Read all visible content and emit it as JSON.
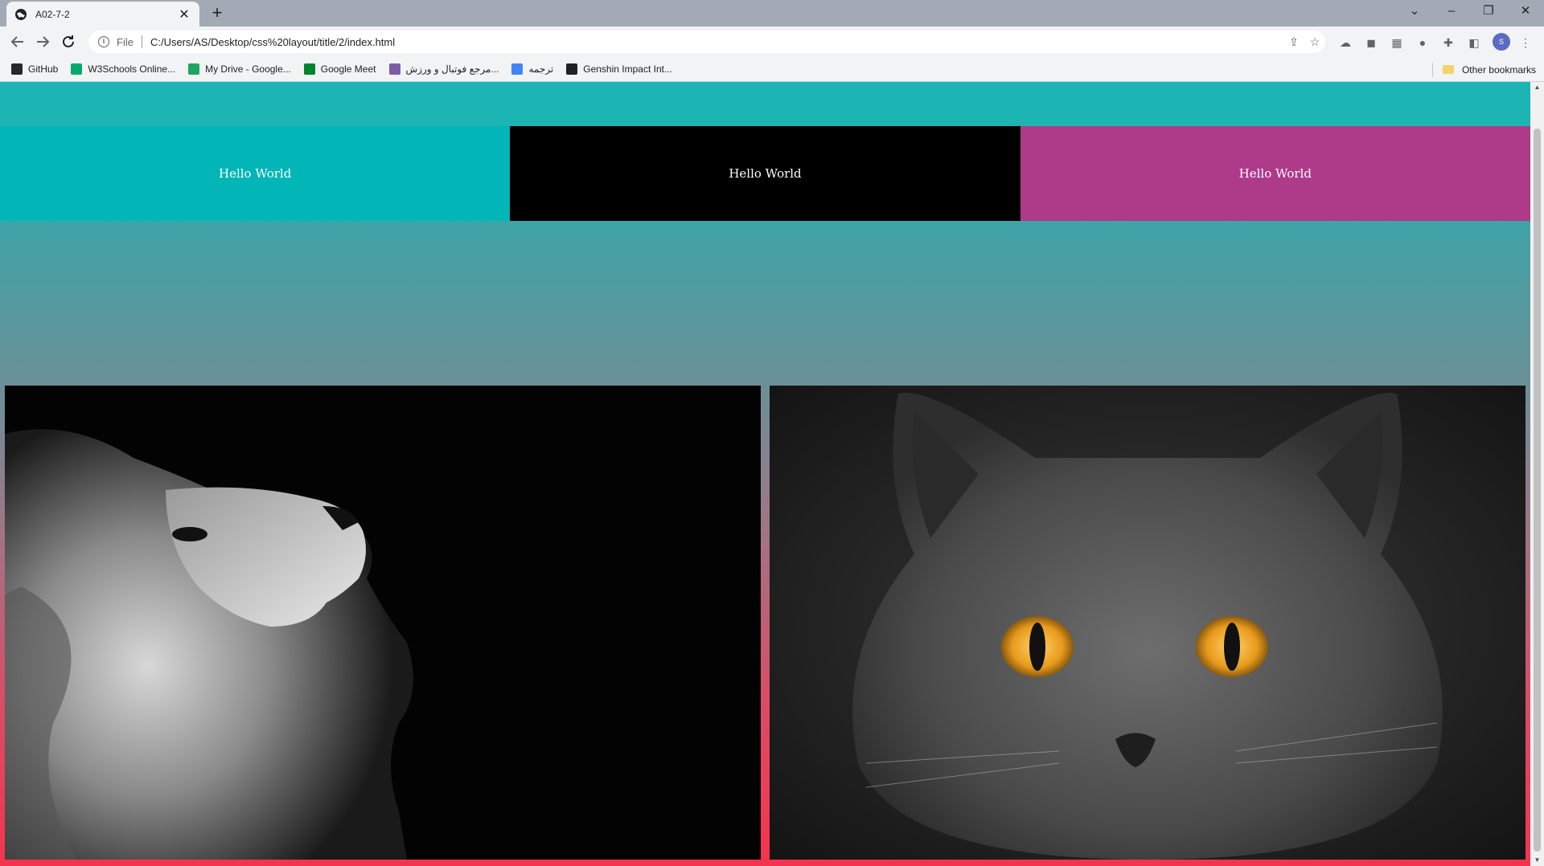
{
  "browser": {
    "tab": {
      "title": "A02-7-2",
      "close_glyph": "✕"
    },
    "new_tab_glyph": "+",
    "window_controls": {
      "tab_search": "⌄",
      "minimize": "–",
      "restore": "❐",
      "close": "✕"
    },
    "address": {
      "scheme_label": "File",
      "url": "C:/Users/AS/Desktop/css%20layout/title/2/index.html"
    },
    "avatar_letter": "S",
    "bookmarks": [
      {
        "label": "GitHub",
        "icon": "github-icon",
        "color": "#24292e"
      },
      {
        "label": "W3Schools Online...",
        "icon": "w3schools-icon",
        "color": "#04aa6d"
      },
      {
        "label": "My Drive - Google...",
        "icon": "google-drive-icon",
        "color": "#1fa463"
      },
      {
        "label": "Google Meet",
        "icon": "google-meet-icon",
        "color": "#00832d"
      },
      {
        "label": "مرجع فوتبال و ورزش...",
        "icon": "sport-site-icon",
        "color": "#7b5ea7"
      },
      {
        "label": "ترجمه",
        "icon": "google-translate-icon",
        "color": "#4285f4"
      },
      {
        "label": "Genshin Impact Int...",
        "icon": "globe-icon",
        "color": "#202124"
      }
    ],
    "other_bookmarks": "Other bookmarks"
  },
  "page": {
    "boxes": [
      {
        "text": "Hello World",
        "color": "#02b5b7"
      },
      {
        "text": "Hello World",
        "color": "#000000"
      },
      {
        "text": "Hello World",
        "color": "#ae3a8a"
      }
    ],
    "images": [
      {
        "name": "lion-image",
        "subject": "lion looking upward, black and white"
      },
      {
        "name": "cat-image",
        "subject": "grey cat with orange eyes"
      }
    ]
  }
}
